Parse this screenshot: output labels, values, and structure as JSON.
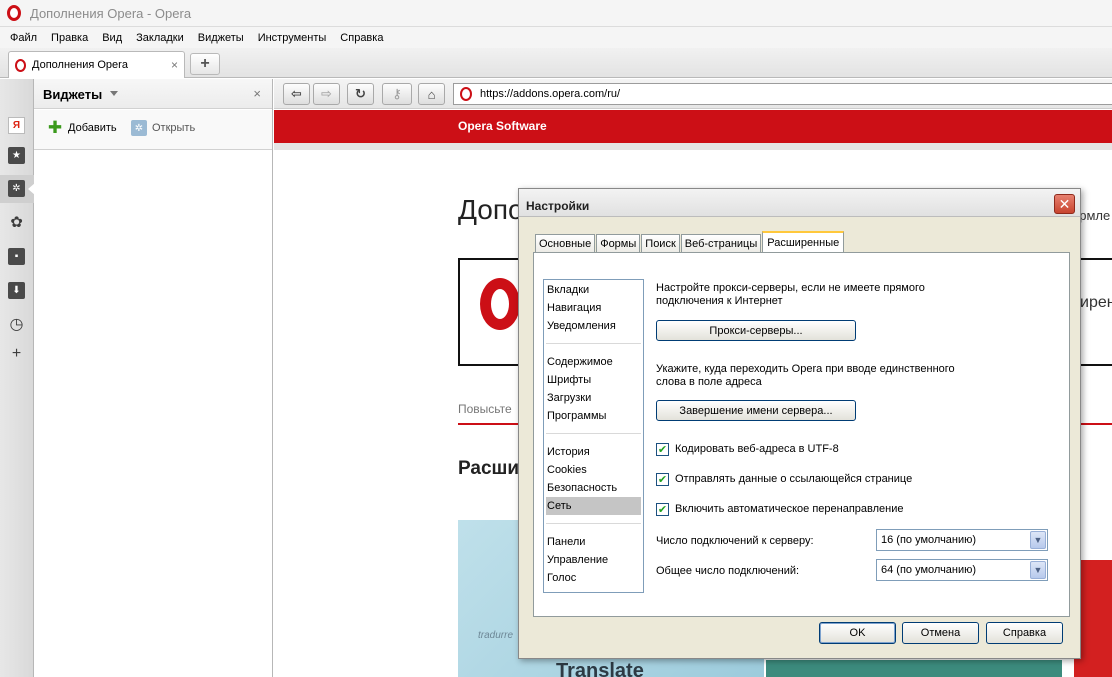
{
  "window": {
    "title": "Дополнения Opera - Opera"
  },
  "menu": [
    "Файл",
    "Правка",
    "Вид",
    "Закладки",
    "Виджеты",
    "Инструменты",
    "Справка"
  ],
  "tab": {
    "label": "Дополнения Opera",
    "close": "×",
    "new_tab": "+"
  },
  "address_bar": {
    "url": "https://addons.opera.com/ru/"
  },
  "left_bar": {
    "yandex_glyph": "Я"
  },
  "panel": {
    "title": "Виджеты",
    "close": "×",
    "add_label": "Добавить",
    "open_label": "Открыть"
  },
  "page": {
    "brand": "Opera Software",
    "heading": "Допо",
    "heading_right": "ормле",
    "promo_right": "ирен",
    "promo_link": "Повысьте",
    "section_heading": "Расши",
    "thumb_label": "Translate",
    "thumb_small": "tradurre"
  },
  "dialog": {
    "title": "Настройки",
    "close": "✕",
    "tabs": [
      {
        "label": "Основные",
        "active": false
      },
      {
        "label": "Формы",
        "active": false
      },
      {
        "label": "Поиск",
        "active": false
      },
      {
        "label": "Веб-страницы",
        "active": false
      },
      {
        "label": "Расширенные",
        "active": true
      }
    ],
    "categories": [
      {
        "label": "Вкладки"
      },
      {
        "label": "Навигация"
      },
      {
        "label": "Уведомления"
      },
      {
        "label": "Содержимое"
      },
      {
        "label": "Шрифты"
      },
      {
        "label": "Загрузки"
      },
      {
        "label": "Программы"
      },
      {
        "label": "История"
      },
      {
        "label": "Cookies"
      },
      {
        "label": "Безопасность"
      },
      {
        "label": "Сеть",
        "selected": true
      },
      {
        "label": "Панели"
      },
      {
        "label": "Управление"
      },
      {
        "label": "Голос"
      }
    ],
    "network": {
      "proxy_text_1": "Настройте прокси-серверы, если не имеете прямого",
      "proxy_text_2": "подключения к Интернет",
      "proxy_button": "Прокси-серверы...",
      "complete_text_1": "Укажите, куда переходить Opera при вводе единственного",
      "complete_text_2": "слова в поле адреса",
      "complete_button": "Завершение имени сервера...",
      "checkboxes": [
        {
          "label": "Кодировать веб-адреса в UTF-8",
          "checked": true
        },
        {
          "label": "Отправлять данные о ссылающейся странице",
          "checked": true
        },
        {
          "label": "Включить автоматическое перенаправление",
          "checked": true
        }
      ],
      "server_conn_label": "Число подключений к серверу:",
      "server_conn_value": "16 (по умолчанию)",
      "total_conn_label": "Общее число подключений:",
      "total_conn_value": "64 (по умолчанию)"
    },
    "buttons": {
      "ok": "OK",
      "cancel": "Отмена",
      "help": "Справка"
    }
  },
  "colors": {
    "opera_red": "#cc0f16",
    "check_green": "#21a121"
  }
}
